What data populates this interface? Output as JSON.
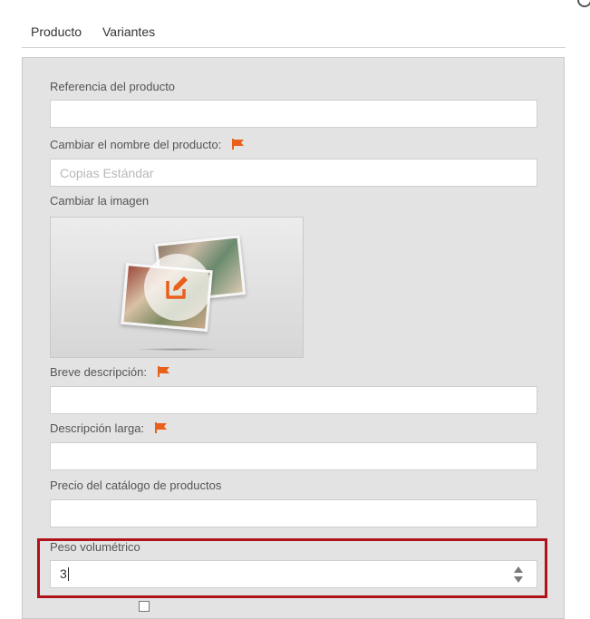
{
  "tabs": [
    {
      "label": "Producto"
    },
    {
      "label": "Variantes"
    }
  ],
  "form": {
    "reference": {
      "label": "Referencia del producto",
      "value": ""
    },
    "rename": {
      "label": "Cambiar el nombre del producto:",
      "placeholder": "Copias Estándar",
      "value": ""
    },
    "image": {
      "label": "Cambiar la imagen"
    },
    "short_description": {
      "label": "Breve descripción:",
      "value": ""
    },
    "long_description": {
      "label": "Descripción larga:",
      "value": ""
    },
    "catalog_price": {
      "label": "Precio del catálogo de productos",
      "value": ""
    },
    "volumetric_weight": {
      "label": "Peso volumétrico",
      "value": "3"
    }
  },
  "colors": {
    "flag": "#e8601c",
    "highlight": "#b0141a",
    "edit_icon": "#e8601c"
  },
  "icons": {
    "flag": "flag-icon",
    "edit": "edit-icon",
    "stepper": "stepper-icon"
  }
}
